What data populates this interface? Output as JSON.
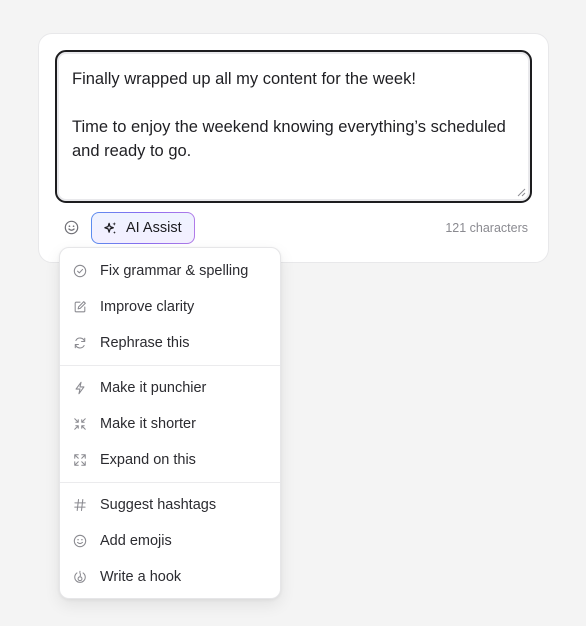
{
  "composer": {
    "text": "Finally wrapped up all my content for the week!\n\nTime to enjoy the weekend knowing everything’s scheduled and ready to go.",
    "char_count": "121 characters",
    "ai_assist_label": "AI Assist"
  },
  "menu": {
    "groups": [
      [
        {
          "label": "Fix grammar & spelling",
          "icon": "check-circle-icon"
        },
        {
          "label": "Improve clarity",
          "icon": "edit-icon"
        },
        {
          "label": "Rephrase this",
          "icon": "refresh-icon"
        }
      ],
      [
        {
          "label": "Make it punchier",
          "icon": "lightning-icon"
        },
        {
          "label": "Make it shorter",
          "icon": "shrink-icon"
        },
        {
          "label": "Expand on this",
          "icon": "expand-icon"
        }
      ],
      [
        {
          "label": "Suggest hashtags",
          "icon": "hash-icon"
        },
        {
          "label": "Add emojis",
          "icon": "smiley-icon"
        },
        {
          "label": "Write a hook",
          "icon": "hook-icon"
        }
      ]
    ]
  },
  "colors": {
    "background": "#f4f4f4",
    "editor_border": "#1d1d1f",
    "ai_gradient_start": "#5b8def",
    "ai_gradient_end": "#b07be8",
    "muted_text": "#8a8a90"
  }
}
